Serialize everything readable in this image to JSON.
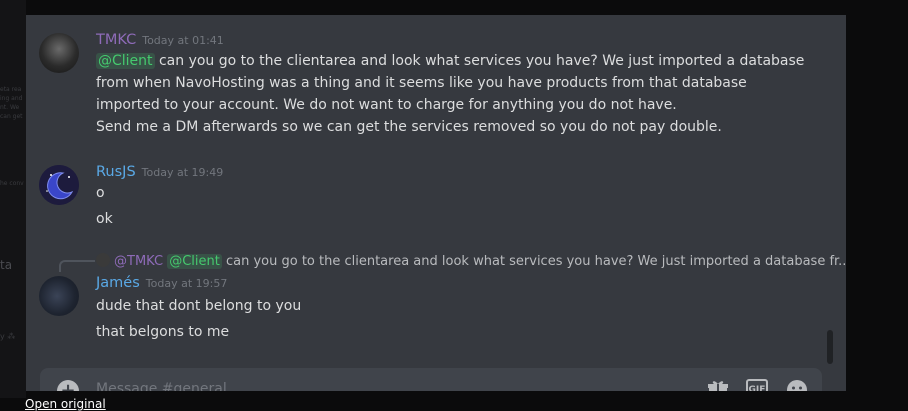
{
  "messages": [
    {
      "username": "TMKC",
      "username_color": "#8e6bb8",
      "timestamp": "Today at 01:41",
      "lines": [
        {
          "mention": "@Client",
          "text": "can you go to the clientarea and look what services you have? We just imported a database"
        },
        {
          "text": "from when NavoHosting was a thing and it seems like you have products from that database"
        },
        {
          "text": "imported to your account. We do not want to charge for anything you do not have."
        },
        {
          "text": "Send me a DM afterwards so we can get the services removed so you do not pay double."
        }
      ]
    },
    {
      "username": "RusJS",
      "username_color": "#5aa9e6",
      "timestamp": "Today at 19:49",
      "lines": [
        {
          "text": "o"
        },
        {
          "text": "ok"
        }
      ]
    },
    {
      "reply": {
        "user": "@TMKC",
        "mention": "@Client",
        "text": "can you go to the clientarea and look what services you have? We just imported a database fr..."
      },
      "username": "Jamés",
      "username_color": "#5aa9e6",
      "timestamp": "Today at 19:57",
      "lines": [
        {
          "text": "dude that dont belong to you"
        },
        {
          "text": "that belgons to me"
        }
      ]
    }
  ],
  "composer": {
    "placeholder": "Message #general"
  },
  "icons": [
    "plus-icon",
    "gift-icon",
    "gif-icon",
    "emoji-icon"
  ],
  "footer": {
    "open_original": "Open original"
  },
  "colors": {
    "background": "#36393f",
    "mention": "#45c96e",
    "composer": "#40444b"
  }
}
